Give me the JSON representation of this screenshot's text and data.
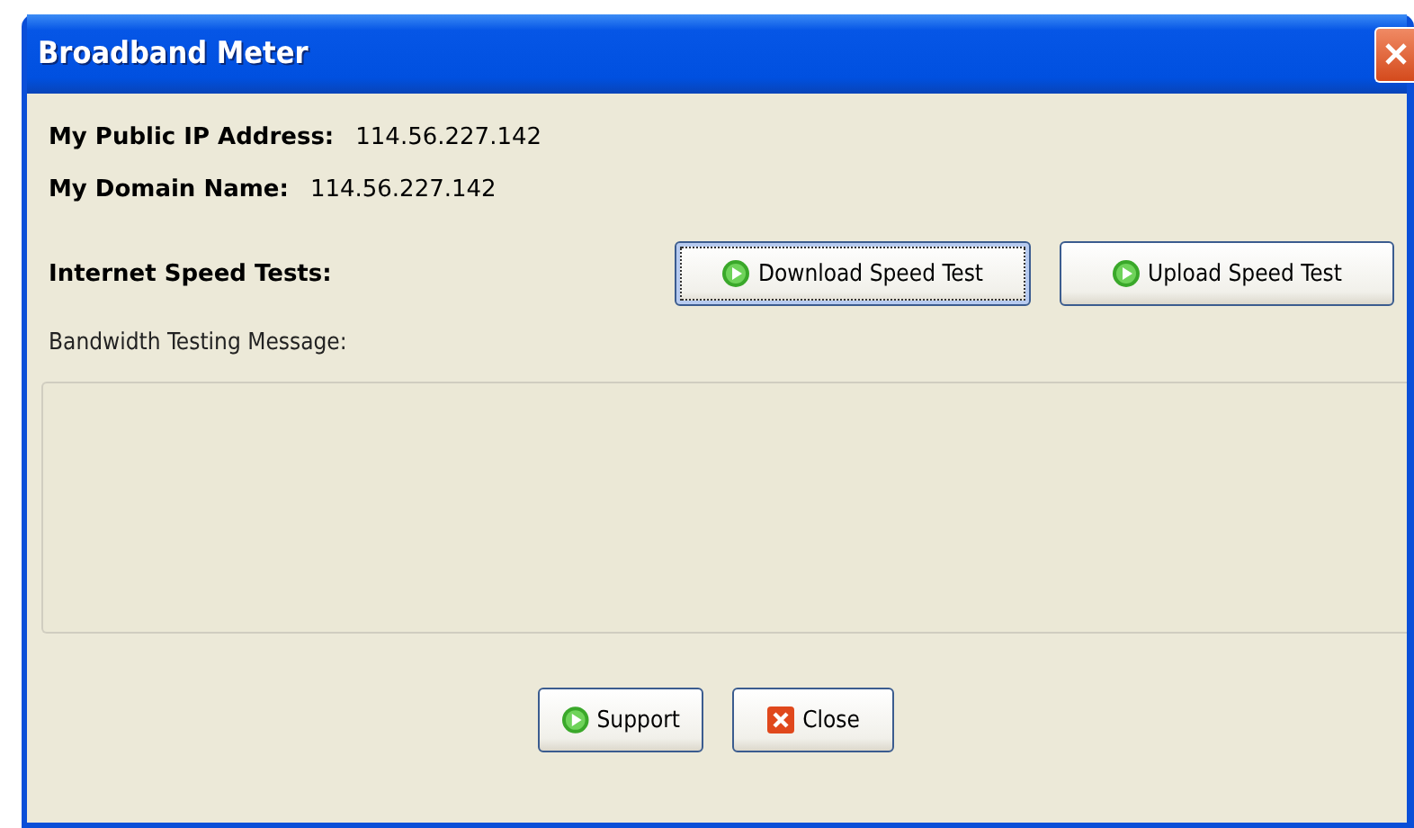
{
  "window": {
    "title": "Broadband Meter"
  },
  "info": [
    {
      "label": "My Public IP Address:",
      "value": "114.56.227.142"
    },
    {
      "label": "My Domain Name:",
      "value": "114.56.227.142"
    }
  ],
  "speed_tests": {
    "label": "Internet Speed Tests:",
    "buttons": [
      {
        "label": "Download Speed Test",
        "kind": "play",
        "focused": true
      },
      {
        "label": "Upload Speed Test",
        "kind": "play",
        "focused": false
      }
    ]
  },
  "message": {
    "label": "Bandwidth Testing Message:"
  },
  "footer_buttons": [
    {
      "label": "Support",
      "kind": "play",
      "focused": false
    },
    {
      "label": "Close",
      "kind": "close",
      "focused": false
    }
  ]
}
